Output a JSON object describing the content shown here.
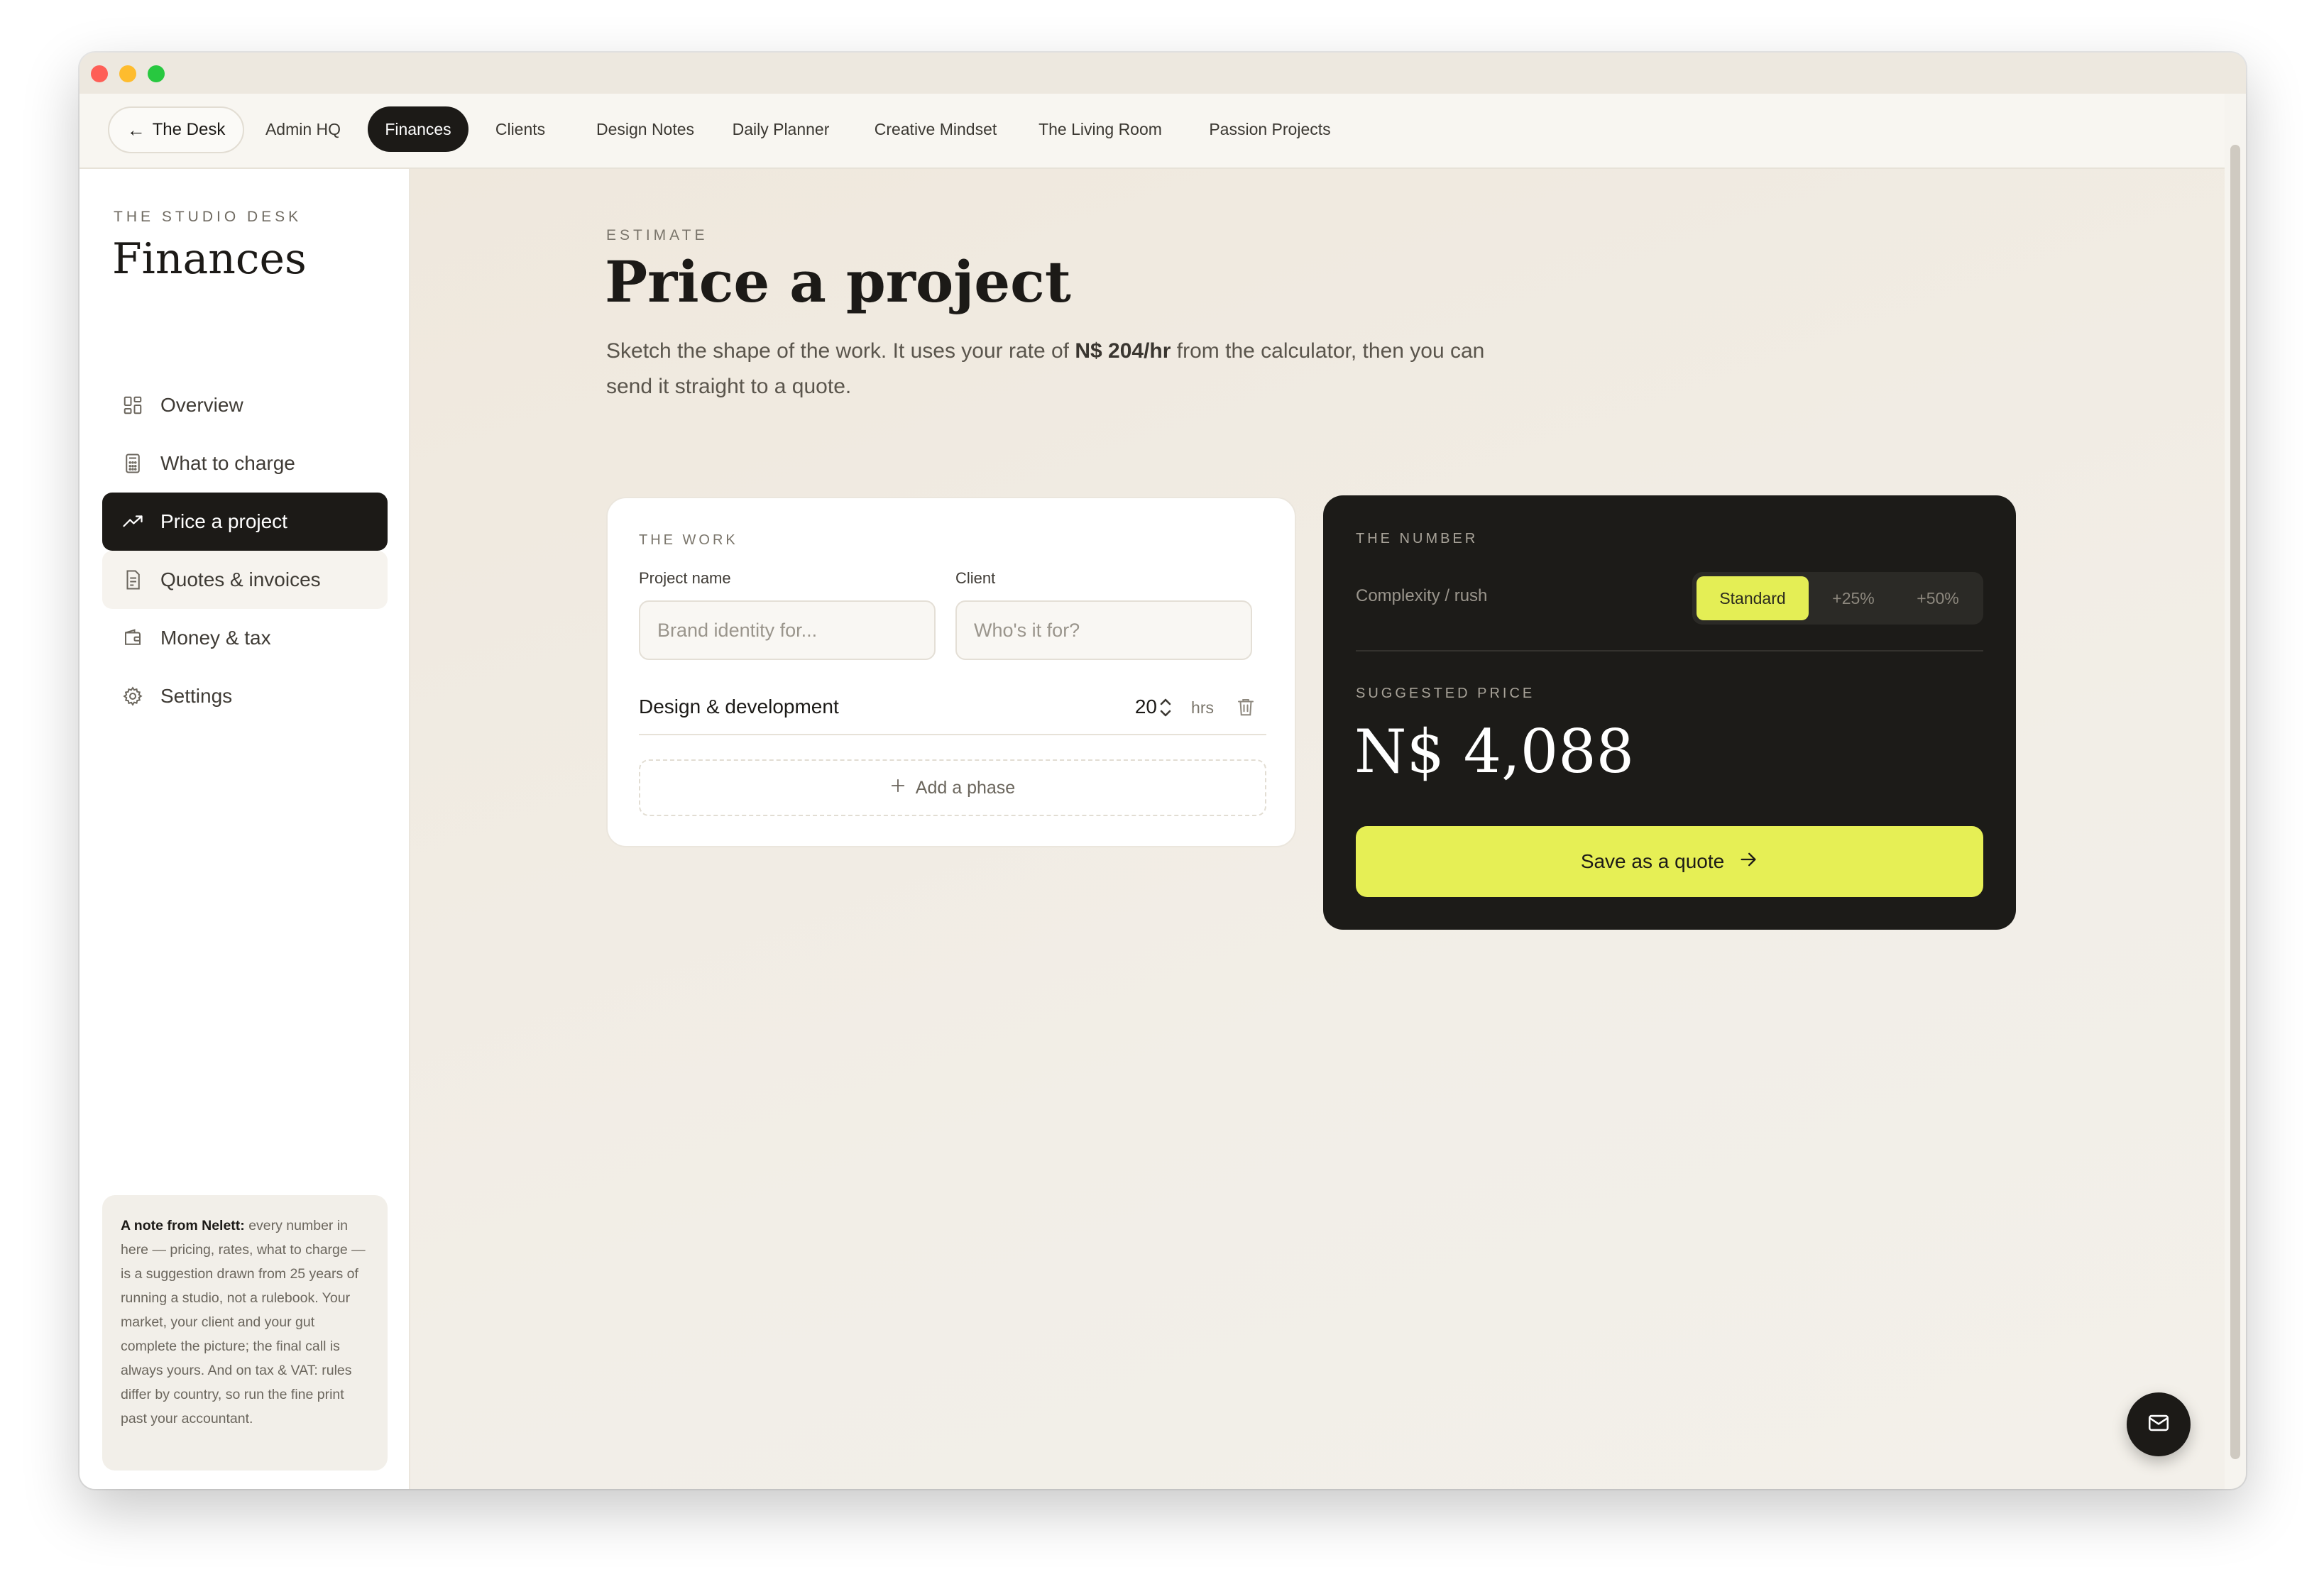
{
  "topnav": {
    "back_label": "The Desk",
    "tabs": [
      {
        "label": "Admin HQ",
        "active": false
      },
      {
        "label": "Finances",
        "active": true
      },
      {
        "label": "Clients",
        "active": false
      },
      {
        "label": "Design Notes",
        "active": false
      },
      {
        "label": "Daily Planner",
        "active": false
      },
      {
        "label": "Creative Mindset",
        "active": false
      },
      {
        "label": "The Living Room",
        "active": false
      },
      {
        "label": "Passion Projects",
        "active": false
      }
    ]
  },
  "sidebar": {
    "kicker": "THE STUDIO DESK",
    "title": "Finances",
    "items": [
      {
        "label": "Overview",
        "icon": "grid-icon"
      },
      {
        "label": "What to charge",
        "icon": "calculator-icon"
      },
      {
        "label": "Price a project",
        "icon": "trending-up-icon",
        "active": true
      },
      {
        "label": "Quotes & invoices",
        "icon": "document-icon"
      },
      {
        "label": "Money & tax",
        "icon": "wallet-icon"
      },
      {
        "label": "Settings",
        "icon": "gear-icon"
      }
    ],
    "note": {
      "lead": "A note from Nelett:",
      "body": " every number in here — pricing, rates, what to charge — is a suggestion drawn from 25 years of running a studio, not a rulebook. Your market, your client and your gut complete the picture; the final call is always yours. And on tax & VAT: rules differ by country, so run the fine print past your accountant."
    }
  },
  "main": {
    "kicker": "ESTIMATE",
    "title": "Price a project",
    "lead_before": "Sketch the shape of the work. It uses your rate of ",
    "lead_rate": "N$ 204/hr",
    "lead_after": " from the calculator, then you can send it straight to a quote."
  },
  "work_card": {
    "label": "THE WORK",
    "project_name_label": "Project name",
    "project_name_placeholder": "Brand identity for...",
    "client_label": "Client",
    "client_placeholder": "Who's it for?",
    "phase": {
      "name": "Design & development",
      "hours": "20",
      "unit": "hrs"
    },
    "add_phase_label": "Add a phase"
  },
  "number_card": {
    "label": "THE NUMBER",
    "complexity_label": "Complexity / rush",
    "options": [
      "Standard",
      "+25%",
      "+50%"
    ],
    "selected": "Standard",
    "suggested_label": "SUGGESTED PRICE",
    "price": "N$ 4,088",
    "save_label": "Save as a quote"
  },
  "colors": {
    "accent": "#e6ef55",
    "dark": "#1c1b18",
    "background": "#f1ece3"
  }
}
